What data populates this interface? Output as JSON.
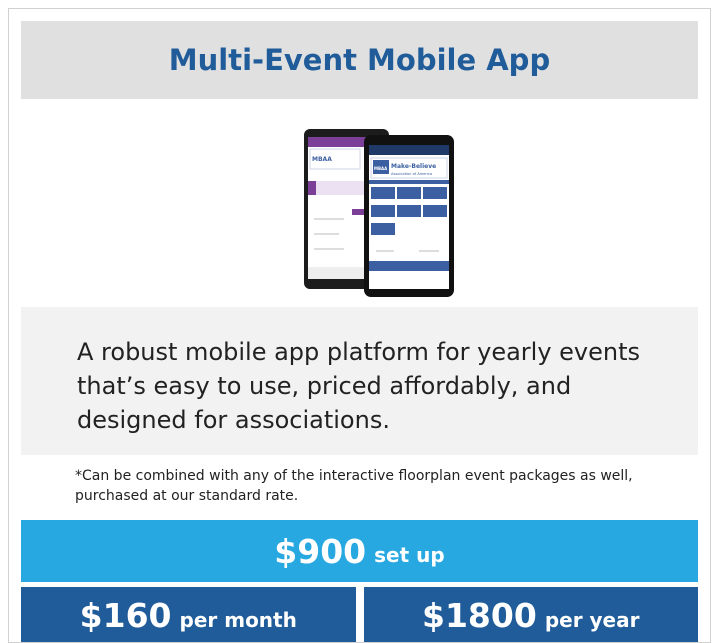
{
  "header": {
    "title": "Multi-Event Mobile App"
  },
  "phone_mock": {
    "logo_short": "MBAA",
    "logo_name": "Make-Believe",
    "logo_sub": "Association of America"
  },
  "description": "A robust mobile app platform for yearly events that’s easy to use, priced affordably, and designed for associations.",
  "note": "*Can be combined with any of the interactive floorplan event packages as well, purchased at our standard rate.",
  "pricing": {
    "setup": {
      "amount": "$900",
      "label": "set up"
    },
    "monthly": {
      "amount": "$160",
      "label": "per month"
    },
    "yearly": {
      "amount": "$1800",
      "label": "per year"
    }
  },
  "colors": {
    "title": "#1f5c99",
    "setup_bg": "#27a8e0",
    "price_bg": "#1f5c99",
    "phone_back_header": "#7b3f98"
  }
}
